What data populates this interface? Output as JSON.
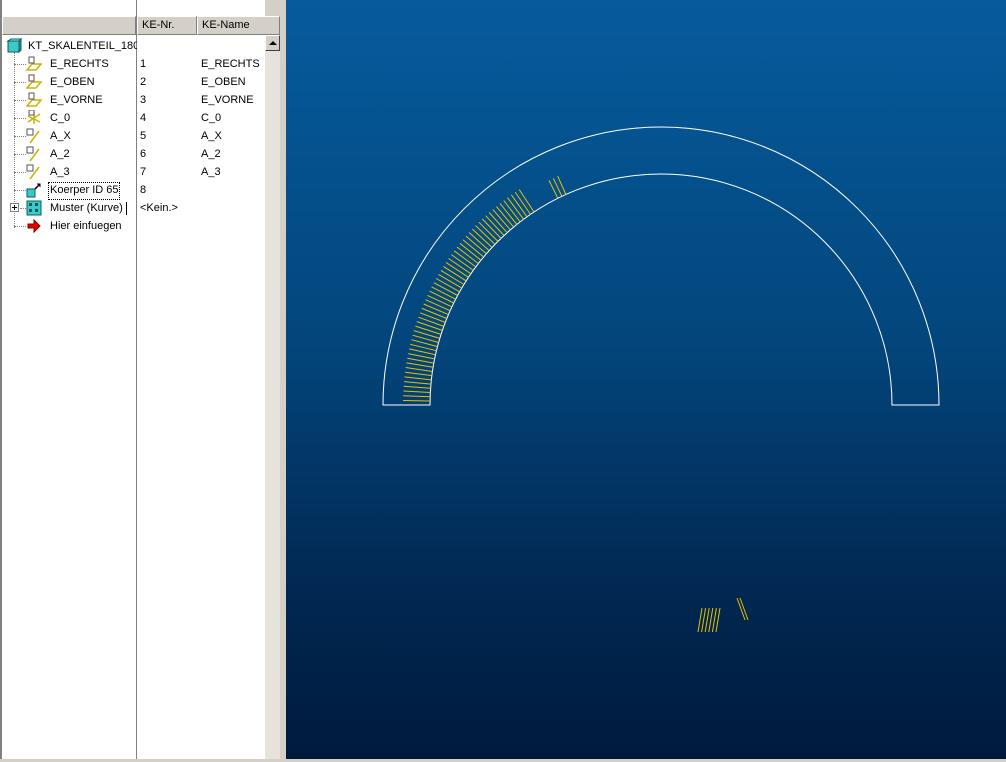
{
  "columns": {
    "nr_header": "KE-Nr.",
    "name_header": "KE-Name"
  },
  "tree": {
    "root": {
      "label": "KT_SKALENTEIL_180",
      "icon": "part-icon"
    },
    "items": [
      {
        "label": "E_RECHTS",
        "nr": "1",
        "name": "E_RECHTS",
        "icon": "datum-plane-icon"
      },
      {
        "label": "E_OBEN",
        "nr": "2",
        "name": "E_OBEN",
        "icon": "datum-plane-icon"
      },
      {
        "label": "E_VORNE",
        "nr": "3",
        "name": "E_VORNE",
        "icon": "datum-plane-icon"
      },
      {
        "label": "C_0",
        "nr": "4",
        "name": "C_0",
        "icon": "coordinate-system-icon"
      },
      {
        "label": "A_X",
        "nr": "5",
        "name": "A_X",
        "icon": "datum-axis-icon"
      },
      {
        "label": "A_2",
        "nr": "6",
        "name": "A_2",
        "icon": "datum-axis-icon"
      },
      {
        "label": "A_3",
        "nr": "7",
        "name": "A_3",
        "icon": "datum-axis-icon"
      },
      {
        "label": "Koerper ID 65",
        "nr": "8",
        "name": "",
        "icon": "body-feature-icon"
      },
      {
        "label": "Muster (Kurve)",
        "nr": "<Kein.>",
        "name": "",
        "icon": "pattern-icon"
      },
      {
        "label": "Hier einfuegen",
        "nr": "",
        "name": "",
        "icon": "insert-here-arrow-icon"
      }
    ]
  },
  "colors": {
    "model_outline": "#ffffff",
    "tick_marks": "#e8c000",
    "viewport_top": "#065b9d",
    "viewport_bottom": "#001a3c"
  }
}
